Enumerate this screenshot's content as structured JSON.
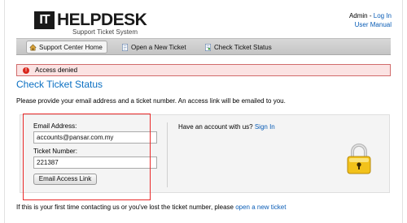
{
  "header": {
    "logo_box": "IT",
    "logo_text": "HELPDESK",
    "logo_sub": "Support Ticket System",
    "user_prefix": "Admin - ",
    "login_link": "Log In",
    "manual_link": "User Manual"
  },
  "nav": {
    "items": [
      {
        "label": "Support Center Home",
        "icon": "home-icon"
      },
      {
        "label": "Open a New Ticket",
        "icon": "new-ticket-icon"
      },
      {
        "label": "Check Ticket Status",
        "icon": "ticket-status-icon"
      }
    ]
  },
  "error": {
    "message": "Access denied"
  },
  "page": {
    "title": "Check Ticket Status",
    "intro": "Please provide your email address and a ticket number. An access link will be emailed to you."
  },
  "form": {
    "email_label": "Email Address:",
    "email_value": "accounts@pansar.com.my",
    "ticket_label": "Ticket Number:",
    "ticket_value": "221387",
    "submit_label": "Email Access Link"
  },
  "account": {
    "text": "Have an account with us? ",
    "link": "Sign In"
  },
  "footer": {
    "text": "If this is your first time contacting us or you've lost the ticket number, please ",
    "link": "open a new ticket"
  },
  "colors": {
    "accent": "#0a6fc2",
    "error_bg": "#fbe3e3",
    "highlight": "#ea2a2a"
  }
}
